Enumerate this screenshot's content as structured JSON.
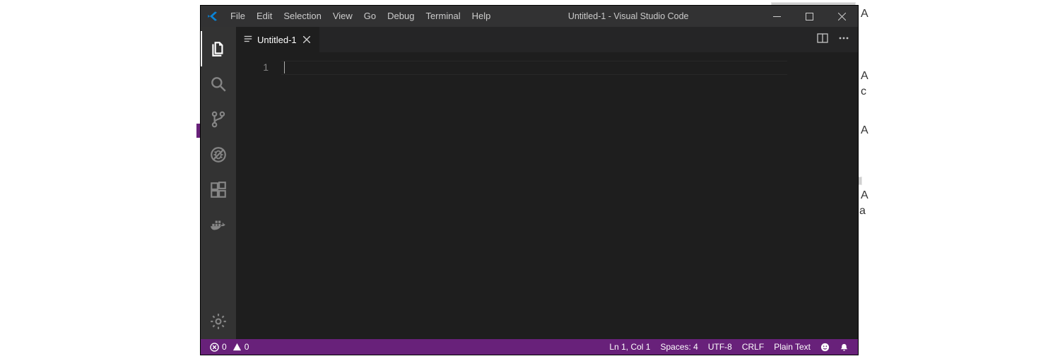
{
  "window": {
    "title": "Untitled-1 - Visual Studio Code"
  },
  "menu": {
    "items": [
      "File",
      "Edit",
      "Selection",
      "View",
      "Go",
      "Debug",
      "Terminal",
      "Help"
    ]
  },
  "activity": {
    "items": [
      {
        "name": "explorer",
        "active": true
      },
      {
        "name": "search",
        "active": false
      },
      {
        "name": "source-control",
        "active": false
      },
      {
        "name": "debug",
        "active": false
      },
      {
        "name": "extensions",
        "active": false
      },
      {
        "name": "docker",
        "active": false
      }
    ],
    "bottom": [
      {
        "name": "settings"
      }
    ]
  },
  "tabs": {
    "items": [
      {
        "label": "Untitled-1",
        "active": true
      }
    ]
  },
  "editor": {
    "line_number": "1",
    "content": ""
  },
  "status": {
    "errors": "0",
    "warnings": "0",
    "cursor": "Ln 1, Col 1",
    "indent": "Spaces: 4",
    "encoding": "UTF-8",
    "eol": "CRLF",
    "language": "Plain Text"
  },
  "background_fragments": {
    "a1": "A",
    "a2": "A",
    "c": "c",
    "a3": "A",
    "a4": "A",
    "a5": "a"
  }
}
